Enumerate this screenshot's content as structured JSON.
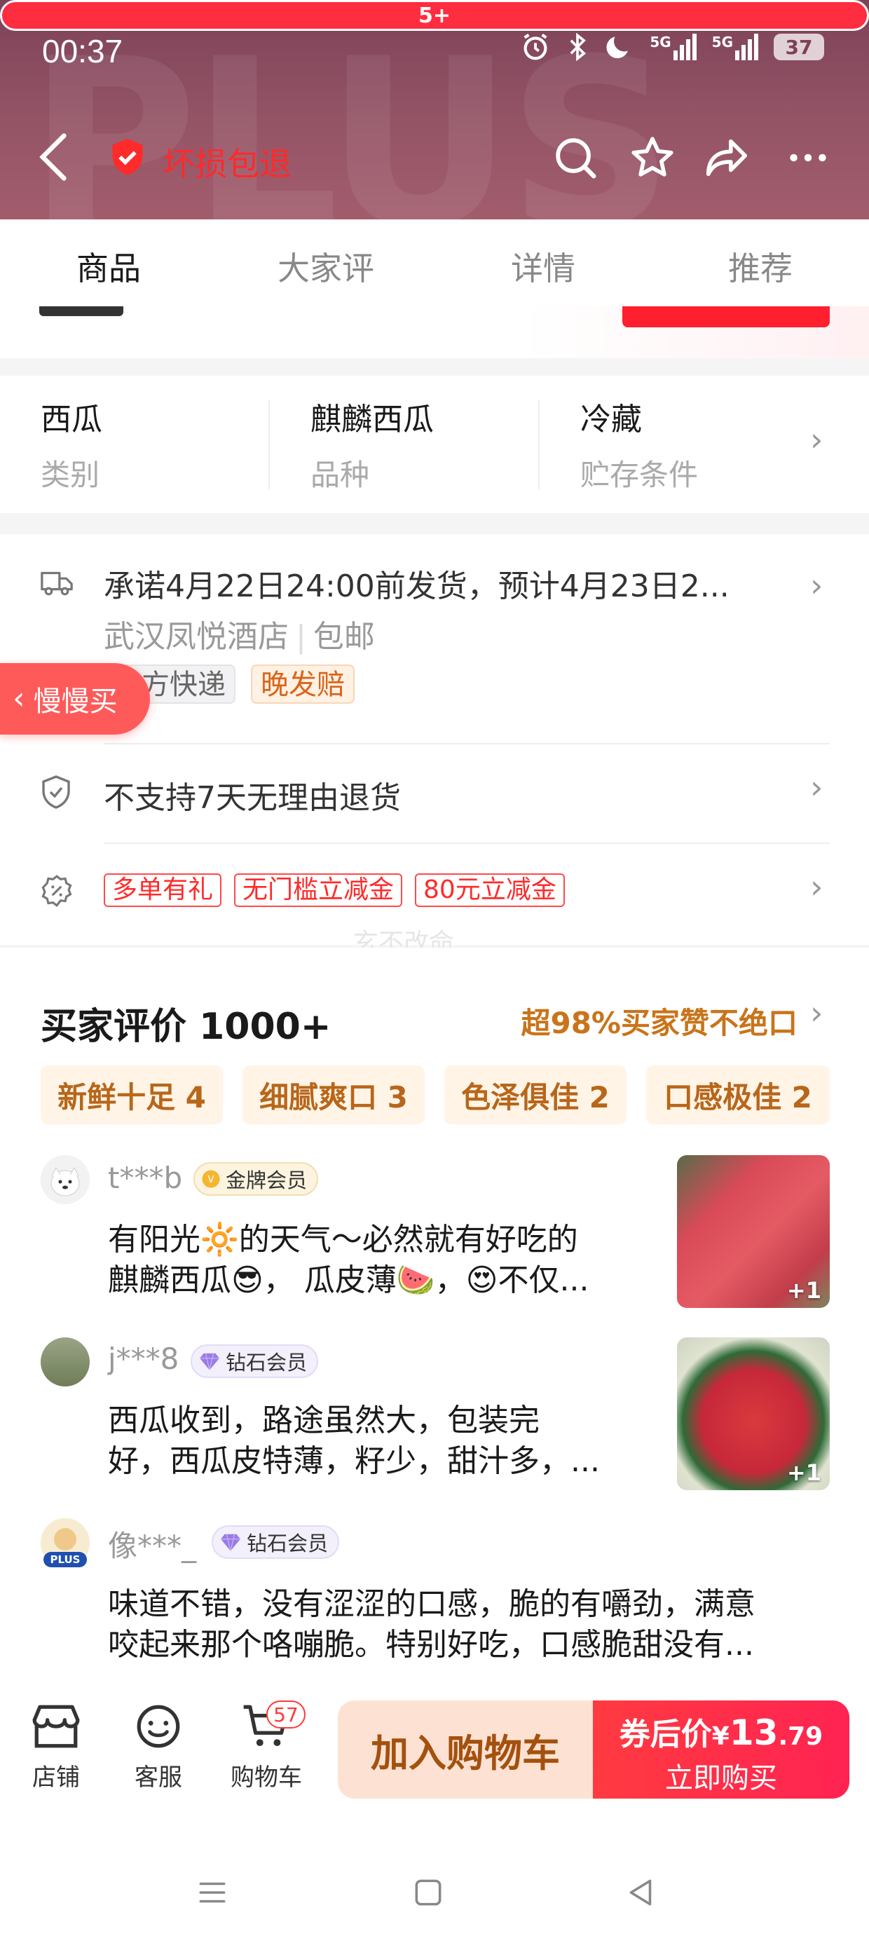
{
  "status_bar": {
    "time": "00:37",
    "network_1": "5G",
    "network_2": "5G",
    "battery": "37"
  },
  "header": {
    "title": "坏损包退",
    "more_badge": "5+",
    "watermark": "PLUS"
  },
  "tabs": [
    {
      "label": "商品",
      "active": true
    },
    {
      "label": "大家评",
      "active": false
    },
    {
      "label": "详情",
      "active": false
    },
    {
      "label": "推荐",
      "active": false
    }
  ],
  "attributes": [
    {
      "value": "西瓜",
      "label": "类别"
    },
    {
      "value": "麒麟西瓜",
      "label": "品种"
    },
    {
      "value": "冷藏",
      "label": "贮存条件"
    }
  ],
  "shipping": {
    "promise": "承诺4月22日24:00前发货，预计4月23日2...",
    "origin": "武汉凤悦酒店",
    "fee": "包邮",
    "tags": [
      "三方快递",
      "晚发赔"
    ]
  },
  "return_policy": "不支持7天无理由退货",
  "promotions": [
    "多单有礼",
    "无门槛立减金",
    "80元立减金"
  ],
  "floating": {
    "slow_buy": "慢慢买",
    "faint_watermark": "玄不改命"
  },
  "reviews": {
    "title": "买家评价 1000+",
    "praise": "超98%买家赞不绝口",
    "tags": [
      "新鲜十足 4",
      "细腻爽口 3",
      "色泽俱佳 2",
      "口感极佳 2"
    ],
    "items": [
      {
        "user": "t***b",
        "level": "金牌会员",
        "line1": "有阳光🔆的天气～必然就有好吃的",
        "line2": "麒麟西瓜😎， 瓜皮薄🍉，😍不仅...",
        "photo_count": "+1"
      },
      {
        "user": "j***8",
        "level": "钻石会员",
        "line1": "西瓜收到，路途虽然大，包装完",
        "line2": "好，西瓜皮特薄，籽少，甜汁多，...",
        "photo_count": "+1"
      },
      {
        "user": "像***_",
        "level": "钻石会员",
        "line1": "味道不错，没有涩涩的口感，脆的有嚼劲，满意",
        "line2": "咬起来那个咯嘣脆。特别好吃，口感脆甜没有...",
        "avatar_badge": "PLUS"
      }
    ]
  },
  "bottom_bar": {
    "store": "店铺",
    "service": "客服",
    "cart": "购物车",
    "cart_count": "57",
    "add_to_cart": "加入购物车",
    "price_label": "券后价",
    "currency": "¥",
    "price_int": "13",
    "price_dec": ".79",
    "buy_now": "立即购买"
  },
  "colors": {
    "accent": "#ff2a2a",
    "header_bg": "#8b4a60",
    "review_tag": "#b8661a"
  }
}
